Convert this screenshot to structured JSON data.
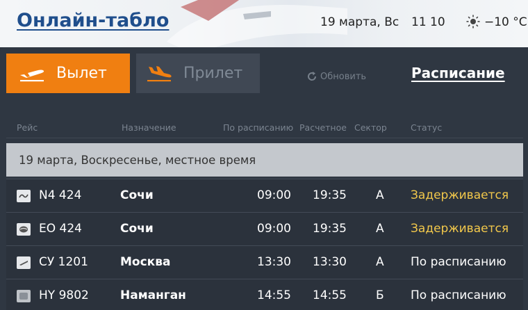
{
  "header": {
    "title": "Онлайн-табло",
    "date": "19 марта, Вс",
    "time": "11 10",
    "temperature": "−10 °C",
    "weather_icon": "sun-icon"
  },
  "tabs": [
    {
      "label": "Вылет",
      "active": true,
      "icon": "departure-plane-icon"
    },
    {
      "label": "Прилет",
      "active": false,
      "icon": "arrival-plane-icon"
    }
  ],
  "refresh_label": "Обновить",
  "schedule_link": "Расписание",
  "columns": [
    "Рейс",
    "Назначение",
    "По расписанию",
    "Расчетное",
    "Сектор",
    "Статус"
  ],
  "date_row": "19 марта, Воскресенье, местное время",
  "flights": [
    {
      "flight": "N4 424",
      "destination": "Сочи",
      "scheduled": "09:00",
      "estimated": "19:35",
      "sector": "А",
      "status": "Задерживается",
      "status_type": "delayed"
    },
    {
      "flight": "EO 424",
      "destination": "Сочи",
      "scheduled": "09:00",
      "estimated": "19:35",
      "sector": "А",
      "status": "Задерживается",
      "status_type": "delayed"
    },
    {
      "flight": "СУ 1201",
      "destination": "Москва",
      "scheduled": "13:30",
      "estimated": "13:30",
      "sector": "А",
      "status": "По расписанию",
      "status_type": "on-time"
    },
    {
      "flight": "HY 9802",
      "destination": "Наманган",
      "scheduled": "14:55",
      "estimated": "14:55",
      "sector": "Б",
      "status": "По расписанию",
      "status_type": "on-time"
    }
  ],
  "colors": {
    "accent": "#f07f11",
    "delayed": "#f2c84b",
    "title": "#1f4e8c"
  }
}
